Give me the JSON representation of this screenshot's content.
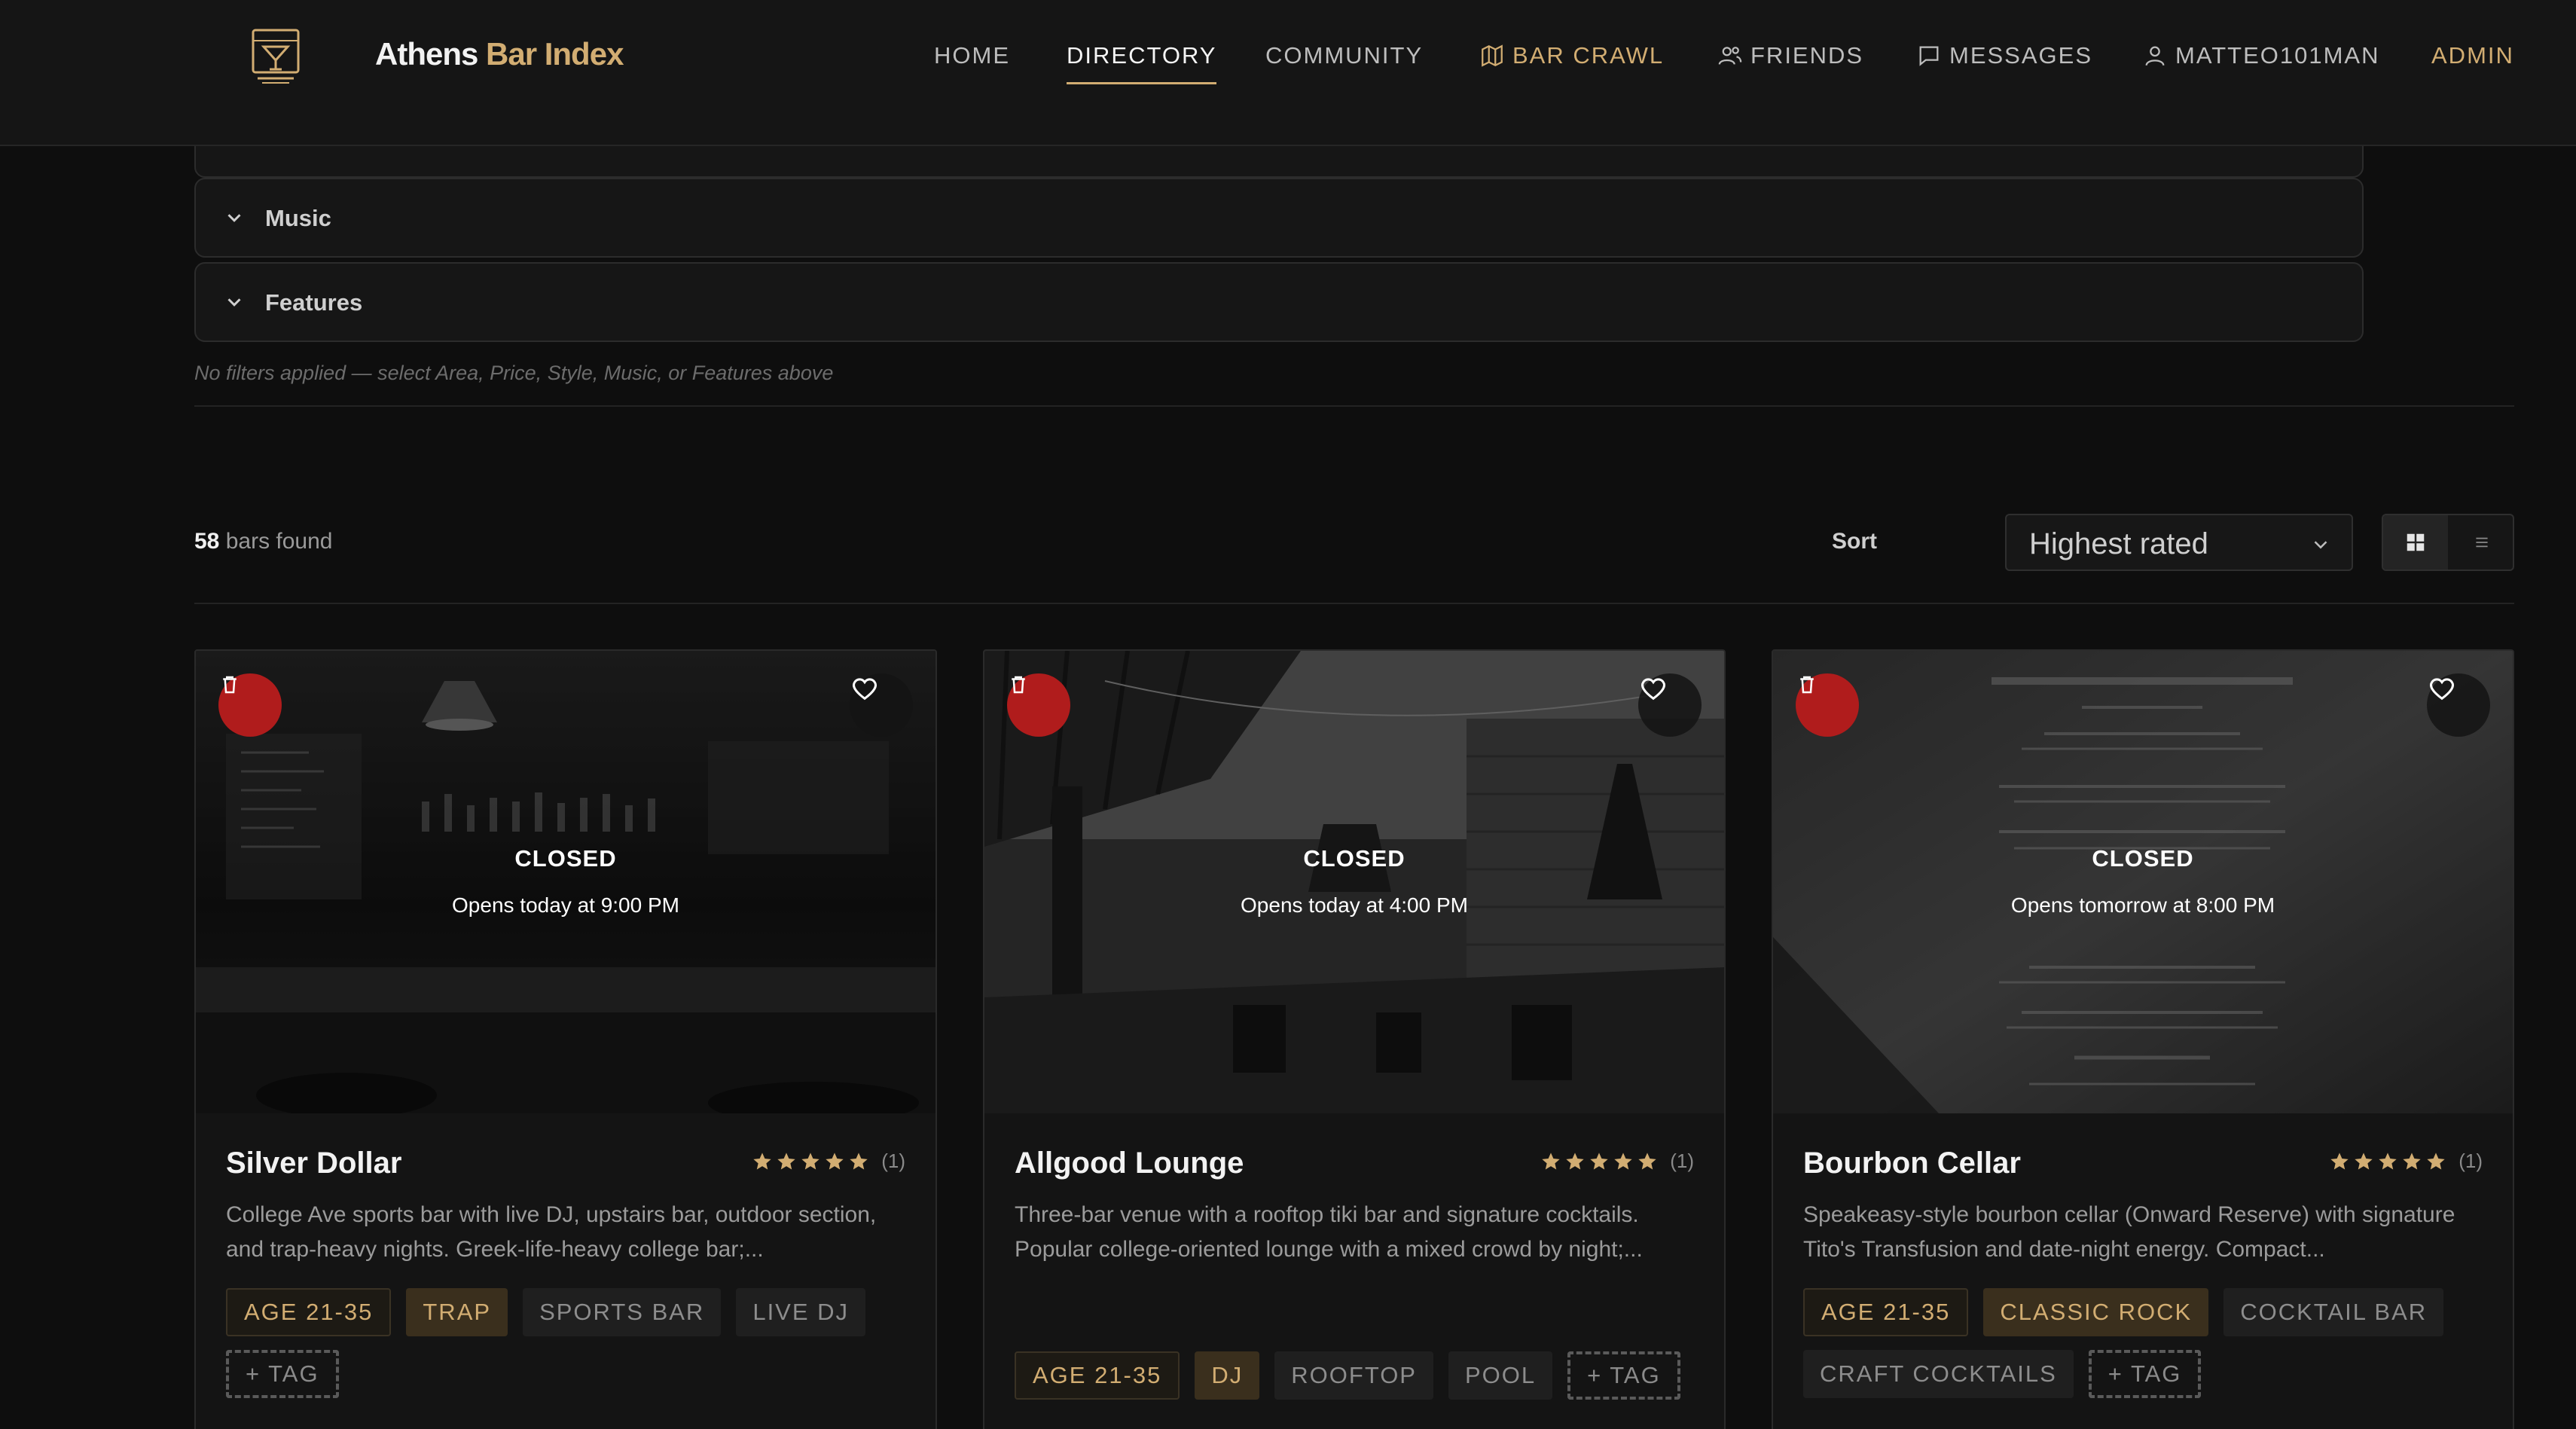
{
  "header": {
    "brand_white": "Athens",
    "brand_gold": "Bar Index",
    "nav": [
      {
        "label": "HOME",
        "icon": ""
      },
      {
        "label": "DIRECTORY",
        "icon": ""
      },
      {
        "label": "COMMUNITY",
        "icon": ""
      },
      {
        "label": "BAR CRAWL",
        "icon": "map-icon"
      },
      {
        "label": "FRIENDS",
        "icon": "users-icon"
      },
      {
        "label": "MESSAGES",
        "icon": "message-icon"
      },
      {
        "label": "MATTEO101MAN",
        "icon": "user-icon"
      },
      {
        "label": "ADMIN",
        "icon": ""
      }
    ]
  },
  "filters": {
    "sections": [
      "Music",
      "Features"
    ],
    "note": "No filters applied — select Area, Price, Style, Music, or Features above"
  },
  "results": {
    "count": "58",
    "count_suffix": "bars found",
    "sort_label": "Sort",
    "sort_value": "Highest rated"
  },
  "bars": [
    {
      "name": "Silver Dollar",
      "status": "CLOSED",
      "opens": "Opens today at 9:00 PM",
      "rating": 5,
      "rating_count": "(1)",
      "description": "College Ave sports bar with live DJ, upstairs bar, outdoor section, and trap-heavy nights. Greek-life-heavy college bar;...",
      "tags": [
        {
          "label": "AGE 21-35",
          "kind": "age"
        },
        {
          "label": "TRAP",
          "kind": "hot"
        },
        {
          "label": "SPORTS BAR",
          "kind": "plain"
        },
        {
          "label": "LIVE DJ",
          "kind": "plain"
        },
        {
          "label": "+ TAG",
          "kind": "add"
        }
      ]
    },
    {
      "name": "Allgood Lounge",
      "status": "CLOSED",
      "opens": "Opens today at 4:00 PM",
      "rating": 5,
      "rating_count": "(1)",
      "description": "Three-bar venue with a rooftop tiki bar and signature cocktails. Popular college-oriented lounge with a mixed crowd by night;...",
      "tags": [
        {
          "label": "AGE 21-35",
          "kind": "age"
        },
        {
          "label": "DJ",
          "kind": "hot"
        },
        {
          "label": "ROOFTOP",
          "kind": "plain"
        },
        {
          "label": "POOL",
          "kind": "plain"
        },
        {
          "label": "+ TAG",
          "kind": "add"
        }
      ]
    },
    {
      "name": "Bourbon Cellar",
      "status": "CLOSED",
      "opens": "Opens tomorrow at 8:00 PM",
      "rating": 5,
      "rating_count": "(1)",
      "description": "Speakeasy-style bourbon cellar (Onward Reserve) with signature Tito's Transfusion and date-night energy. Compact...",
      "tags": [
        {
          "label": "AGE 21-35",
          "kind": "age"
        },
        {
          "label": "CLASSIC ROCK",
          "kind": "hot"
        },
        {
          "label": "COCKTAIL BAR",
          "kind": "plain"
        },
        {
          "label": "CRAFT COCKTAILS",
          "kind": "plain"
        },
        {
          "label": "+ TAG",
          "kind": "add"
        }
      ]
    }
  ],
  "colors": {
    "accent": "#d2ad72",
    "background": "#0e0e0e",
    "delete": "#b01c1c"
  }
}
